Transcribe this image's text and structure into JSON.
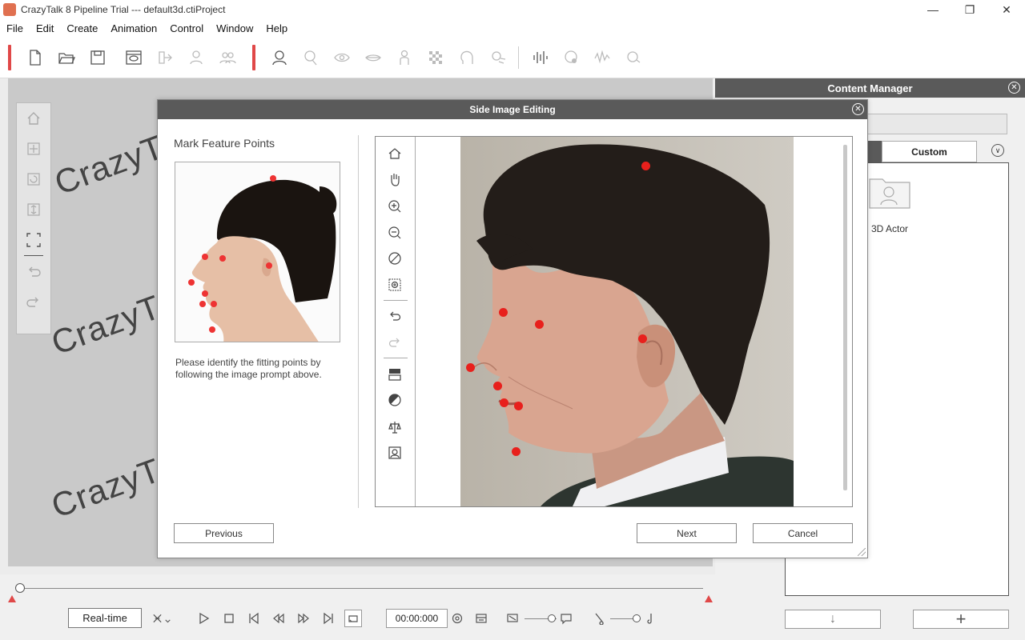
{
  "window": {
    "title": "CrazyTalk 8 Pipeline Trial --- default3d.ctiProject"
  },
  "menu": [
    "File",
    "Edit",
    "Create",
    "Animation",
    "Control",
    "Window",
    "Help"
  ],
  "stage": {
    "watermark": "CrazyTalk"
  },
  "content_manager": {
    "title": "Content Manager",
    "tab_custom": "Custom",
    "item_label": "3D Actor"
  },
  "dialog": {
    "title": "Side Image Editing",
    "heading": "Mark Feature Points",
    "hint": "Please identify the fitting points by following the image prompt above.",
    "buttons": {
      "previous": "Previous",
      "next": "Next",
      "cancel": "Cancel"
    }
  },
  "timeline": {
    "realtime_label": "Real-time",
    "time": "00:00:000"
  },
  "colors": {
    "accent": "#e04848",
    "feature_point": "#e8201c",
    "dialog_title_bg": "#5a5a5a",
    "stage_bg": "#c9c9c9"
  }
}
